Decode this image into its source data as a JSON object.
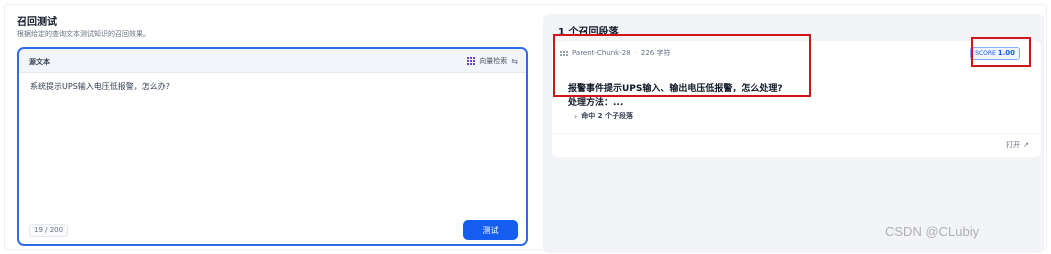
{
  "left": {
    "title": "召回测试",
    "subtitle": "根据给定的查询文本测试知识的召回效果。",
    "editor": {
      "label": "源文本",
      "mode_label": "向量检索",
      "query": "系统提示UPS输入电压低报警，怎么办?",
      "counter": "19 / 200",
      "test_button": "测试"
    }
  },
  "right": {
    "title": "1 个召回段落",
    "result": {
      "chunk_name": "Parent-Chunk-28",
      "separator": "·",
      "char_count": "226 字符",
      "score_label": "SCORE",
      "score_value": "1.00",
      "title_line1": "报警事件提示UPS输入、输出电压低报警，怎么处理?",
      "title_line2": "处理方法：...",
      "hits_label": "命中 2 个子段落",
      "open_label": "打开"
    }
  },
  "watermark": "CSDN @CLubiy",
  "colors": {
    "accent": "#155eef",
    "highlight": "#d0141c"
  },
  "icons": [
    "grid-icon",
    "swap-icon",
    "chunk-icon",
    "chevron-right-icon",
    "external-link-icon"
  ]
}
